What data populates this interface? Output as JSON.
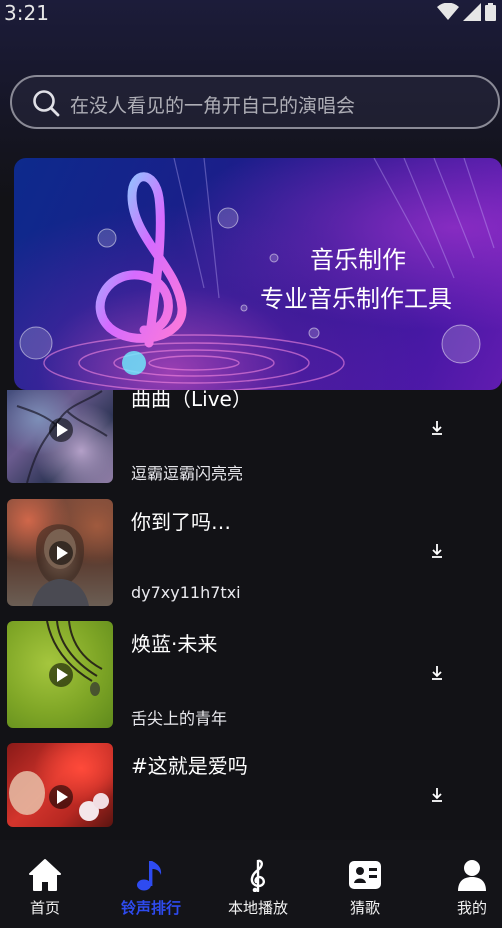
{
  "status_bar": {
    "time": "3:21"
  },
  "search": {
    "placeholder": "在没人看见的一角开自己的演唱会"
  },
  "banner": {
    "line1": "音乐制作",
    "line2": "专业音乐制作工具"
  },
  "songs": [
    {
      "title": "曲曲（Live）",
      "artist": "逗霸逗霸闪亮亮"
    },
    {
      "title": "你到了吗…",
      "artist": "dy7xy11h7txi"
    },
    {
      "title": "焕蓝·未来",
      "artist": "舌尖上的青年"
    },
    {
      "title": "#这就是爱吗",
      "artist": ""
    }
  ],
  "nav": {
    "items": [
      {
        "label": "首页",
        "icon": "home-icon"
      },
      {
        "label": "铃声排行",
        "icon": "music-note-icon",
        "active": true
      },
      {
        "label": "本地播放",
        "icon": "treble-clef-icon"
      },
      {
        "label": "猜歌",
        "icon": "id-card-icon"
      },
      {
        "label": "我的",
        "icon": "user-icon"
      }
    ]
  },
  "colors": {
    "accent": "#2e4bf0",
    "background": "#121216"
  }
}
